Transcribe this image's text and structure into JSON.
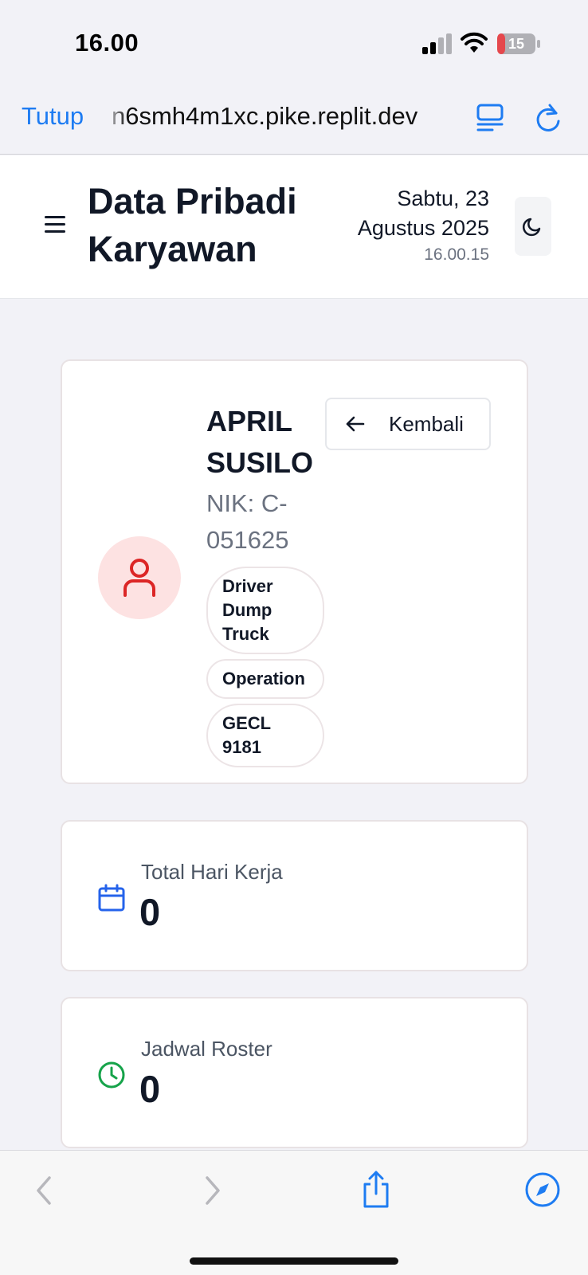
{
  "status_bar": {
    "time": "16.00",
    "battery_level": "15",
    "battery_color": "#e5484d"
  },
  "browser": {
    "close_label": "Tutup",
    "url": "n6smh4m1xc.pike.replit.dev",
    "accent": "#1e7cf2"
  },
  "header": {
    "title_line1": "Data Pribadi",
    "title_line2": "Karyawan",
    "date_line1": "Sabtu, 23",
    "date_line2": "Agustus 2025",
    "time": "16.00.15",
    "theme_icon": "moon-icon"
  },
  "profile": {
    "name_line1": "APRIL",
    "name_line2": "SUSILO",
    "nik_line1": "NIK: C-",
    "nik_line2": "051625",
    "avatar_icon": "user-icon",
    "avatar_color": "#dc2626",
    "position_line1": "Driver",
    "position_line2": "Dump",
    "position_line3": "Truck",
    "department": "Operation",
    "unit_line1": "GECL",
    "unit_line2": "9181",
    "back_label": "Kembali"
  },
  "stats": [
    {
      "label": "Total Hari Kerja",
      "value": "0",
      "icon": "calendar-icon",
      "color": "#2563eb"
    },
    {
      "label": "Jadwal Roster",
      "value": "0",
      "icon": "clock-icon",
      "color": "#16a34a"
    }
  ],
  "toolbar": {
    "icons": [
      "back-icon",
      "forward-icon",
      "share-icon",
      "compass-icon"
    ]
  }
}
